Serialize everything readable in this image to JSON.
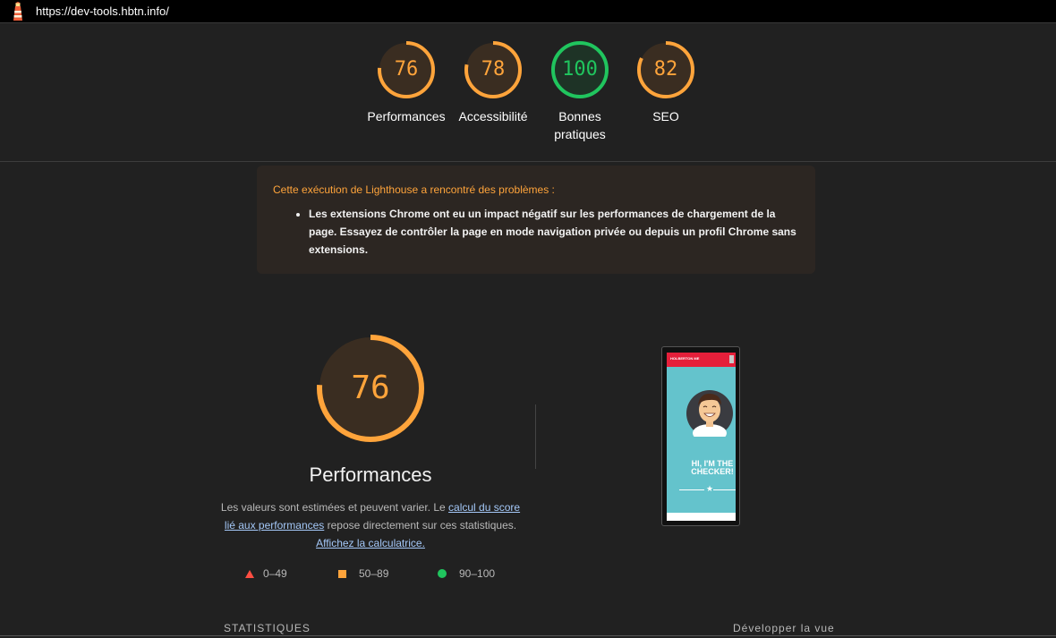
{
  "browser": {
    "url": "https://dev-tools.hbtn.info/"
  },
  "summary": {
    "gauges": [
      {
        "score": "76",
        "label": "Performances",
        "status": "average",
        "color": "#ffa43b"
      },
      {
        "score": "78",
        "label": "Accessibilité",
        "status": "average",
        "color": "#ffa43b"
      },
      {
        "score": "100",
        "label": "Bonnes pratiques",
        "status": "pass",
        "color": "#20c55e"
      },
      {
        "score": "82",
        "label": "SEO",
        "status": "average",
        "color": "#ffa43b"
      }
    ]
  },
  "warning": {
    "title": "Cette exécution de Lighthouse a rencontré des problèmes :",
    "items": [
      "Les extensions Chrome ont eu un impact négatif sur les performances de chargement de la page. Essayez de contrôler la page en mode navigation privée ou depuis un profil Chrome sans extensions."
    ]
  },
  "performance": {
    "score": "76",
    "title": "Performances",
    "desc_part1": "Les valeurs sont estimées et peuvent varier. Le",
    "desc_link1": "calcul du score lié aux performances",
    "desc_part2": "repose directement sur ces statistiques.",
    "desc_link2": "Affichez la calculatrice."
  },
  "legend": {
    "fail": "0–49",
    "average": "50–89",
    "pass": "90–100"
  },
  "screenshot": {
    "header_label": "HOLBERTON ME",
    "hero_line1": "HI, I'M THE",
    "hero_line2": "CHECKER!"
  },
  "sections": {
    "metrics_heading": "STATISTIQUES",
    "expand_view": "Développer la vue"
  }
}
